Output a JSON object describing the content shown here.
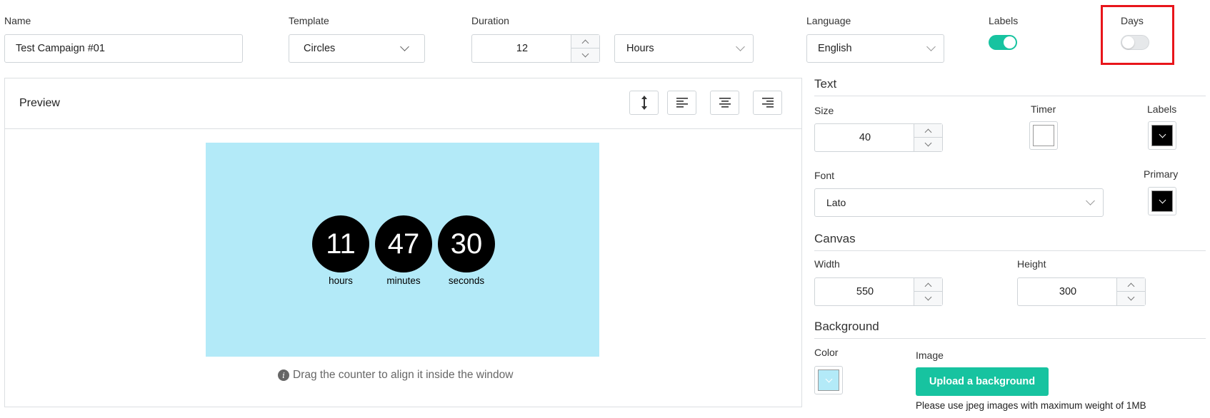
{
  "top": {
    "name": {
      "label": "Name",
      "value": "Test Campaign #01"
    },
    "template": {
      "label": "Template",
      "value": "Circles"
    },
    "duration": {
      "label": "Duration",
      "value": "12",
      "unit": "Hours"
    },
    "language": {
      "label": "Language",
      "value": "English"
    },
    "labels_toggle": {
      "label": "Labels",
      "on": true
    },
    "days_toggle": {
      "label": "Days",
      "on": false
    }
  },
  "preview": {
    "title": "Preview",
    "canvas_color": "#b3eaf8",
    "counters": [
      {
        "value": "11",
        "label": "hours"
      },
      {
        "value": "47",
        "label": "minutes"
      },
      {
        "value": "30",
        "label": "seconds"
      }
    ],
    "hint": "Drag the counter to align it inside the window"
  },
  "text_settings": {
    "title": "Text",
    "size_label": "Size",
    "size_value": "40",
    "timer_label": "Timer",
    "labels_label": "Labels",
    "font_label": "Font",
    "font_value": "Lato",
    "primary_label": "Primary"
  },
  "canvas_settings": {
    "title": "Canvas",
    "width_label": "Width",
    "width_value": "550",
    "height_label": "Height",
    "height_value": "300"
  },
  "background_settings": {
    "title": "Background",
    "color_label": "Color",
    "image_label": "Image",
    "upload_button": "Upload a background",
    "note": "Please use jpeg images with maximum weight of 1MB"
  },
  "colors": {
    "accent": "#17c3a0",
    "highlight": "#e8151b",
    "canvas_bg": "#b3eaf8"
  }
}
